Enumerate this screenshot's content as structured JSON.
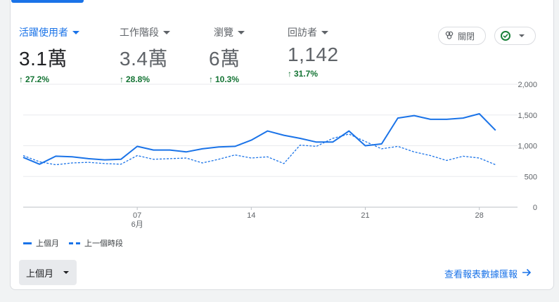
{
  "metrics": [
    {
      "label": "活躍使用者",
      "value": "3.1萬",
      "change": "27.2%",
      "active": true
    },
    {
      "label": "工作階段",
      "value": "3.4萬",
      "change": "28.8%",
      "active": false
    },
    {
      "label": "瀏覽",
      "value": "6萬",
      "change": "10.3%",
      "active": false
    },
    {
      "label": "回訪者",
      "value": "1,142",
      "change": "31.7%",
      "active": false
    }
  ],
  "insights_button": {
    "label": "關閉",
    "icon": "insights-icon"
  },
  "status_button": {
    "icon": "check-circle-icon"
  },
  "colors": {
    "accent": "#1a73e8",
    "positive": "#137333",
    "grid": "#e0e0e0"
  },
  "chart_data": {
    "type": "line",
    "x": [
      "5/31",
      "6/1",
      "6/2",
      "6/3",
      "6/4",
      "6/5",
      "6/6",
      "6/7",
      "6/8",
      "6/9",
      "6/10",
      "6/11",
      "6/12",
      "6/13",
      "6/14",
      "6/15",
      "6/16",
      "6/17",
      "6/18",
      "6/19",
      "6/20",
      "6/21",
      "6/22",
      "6/23",
      "6/24",
      "6/25",
      "6/26",
      "6/27",
      "6/28",
      "6/29",
      "6/30"
    ],
    "x_ticks": [
      {
        "index": 7,
        "label": "07",
        "sublabel": "6月"
      },
      {
        "index": 14,
        "label": "14",
        "sublabel": ""
      },
      {
        "index": 21,
        "label": "21",
        "sublabel": ""
      },
      {
        "index": 28,
        "label": "28",
        "sublabel": ""
      }
    ],
    "y_ticks": [
      "2,000",
      "1,500",
      "1,000",
      "500",
      "0"
    ],
    "ylim": [
      0,
      2000
    ],
    "series": [
      {
        "name": "上個月",
        "style": "solid",
        "values": [
          810,
          700,
          830,
          820,
          790,
          770,
          780,
          990,
          930,
          930,
          900,
          950,
          980,
          990,
          1090,
          1240,
          1170,
          1120,
          1060,
          1060,
          1240,
          1000,
          1030,
          1450,
          1490,
          1430,
          1430,
          1450,
          1520,
          1250
        ]
      },
      {
        "name": "上一個時段",
        "style": "dashed",
        "values": [
          840,
          740,
          690,
          720,
          730,
          710,
          700,
          840,
          780,
          790,
          800,
          720,
          780,
          850,
          800,
          820,
          710,
          1010,
          990,
          1120,
          1190,
          1070,
          950,
          990,
          900,
          840,
          760,
          830,
          800,
          690
        ]
      }
    ]
  },
  "legend": {
    "current": "上個月",
    "previous": "上一個時段"
  },
  "date_range_button": {
    "label": "上個月"
  },
  "report_link": {
    "label": "查看報表數據匯報",
    "icon": "arrow-right-icon"
  }
}
